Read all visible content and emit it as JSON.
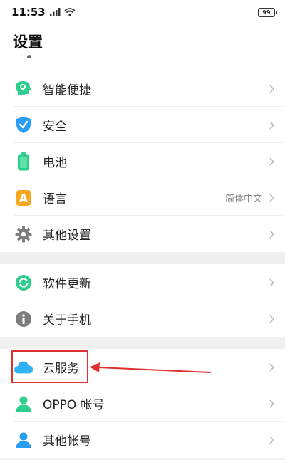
{
  "status_bar": {
    "time": "11:53",
    "battery_level": "99"
  },
  "header": {
    "title": "设置"
  },
  "groups": [
    {
      "items": [
        {
          "label": "智能便捷",
          "icon": "smart-assist-icon"
        },
        {
          "label": "安全",
          "icon": "shield-icon"
        },
        {
          "label": "电池",
          "icon": "battery-icon"
        },
        {
          "label": "语言",
          "value": "简体中文",
          "icon": "language-icon"
        },
        {
          "label": "其他设置",
          "icon": "gear-icon"
        }
      ]
    },
    {
      "items": [
        {
          "label": "软件更新",
          "icon": "refresh-icon"
        },
        {
          "label": "关于手机",
          "icon": "info-icon"
        }
      ]
    },
    {
      "items": [
        {
          "label": "云服务",
          "icon": "cloud-icon"
        },
        {
          "label": "OPPO 帐号",
          "icon": "user-icon"
        },
        {
          "label": "其他帐号",
          "icon": "user-accounts-icon"
        }
      ]
    }
  ],
  "colors": {
    "green": "#2ecf8c",
    "blue": "#2a9df4",
    "orange": "#f7a823",
    "gray_icon": "#7d7d7d",
    "annotation_red": "#e03030"
  }
}
